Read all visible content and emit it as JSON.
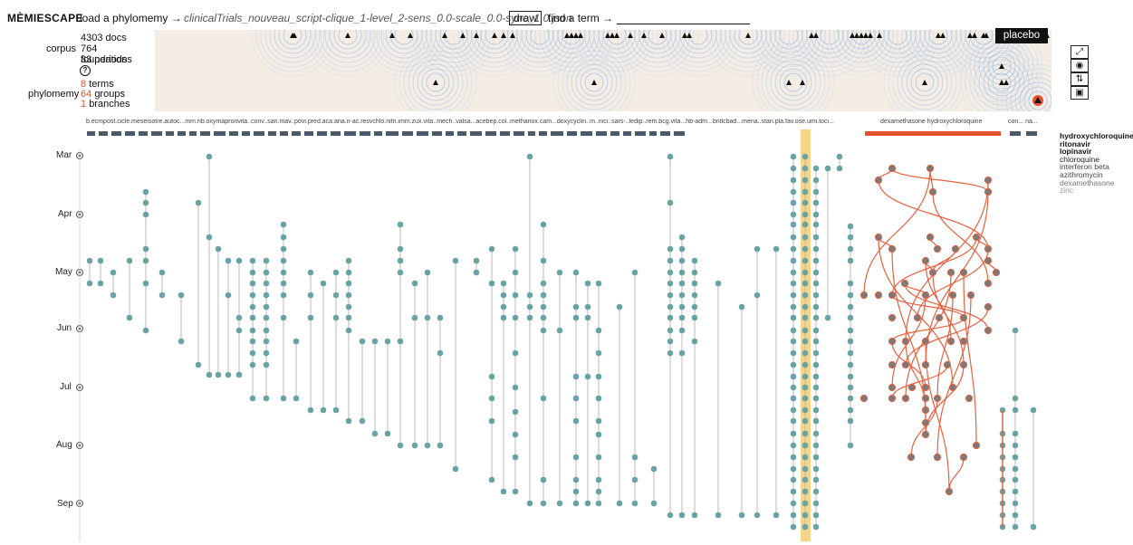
{
  "header": {
    "brand": "MÈMIESCAPE",
    "load_label": "load a phylomemy →",
    "file_name": "clinicalTrials_nouveau_script-clique_1-level_2-sens_0.0-scale_0.0-sync_1.0.json",
    "draw_label": "draw",
    "find_label": "find a term →",
    "find_value": ""
  },
  "stats": {
    "corpus_label": "corpus",
    "docs": "4303 docs",
    "foundations": "764 foundations",
    "periods": "33 periods",
    "help_label": "?",
    "phylomemy_label": "phylomemy",
    "terms_num": "8",
    "terms_label": "terms",
    "groups_num": "64",
    "groups_label": "groups",
    "branches_num": "1",
    "branches_label": "branches"
  },
  "placebo_label": "placebo",
  "term_labels": "b.ecmpost.cicle.meseisotre.autoc...mm.rib.oxymapronvita..conv..sari.mav..povi.pred.aca.ana.n-ac.resvchlo.nitri.imm.zux.vita..mech..valsa...acebep.col..methanox.cam...doxycyclin..m..nici..sars-..ledip..rem.bcg.vita...hb-adm...bntlcbad...mena..stan.pla.fav.ose.umi.toci...",
  "term_label_dexa": "dexamethasone hydroxychloroquine",
  "term_label_tail": "con...   na...",
  "months": [
    "Mar",
    "Apr",
    "May",
    "Jun",
    "Jul",
    "Aug",
    "Sep"
  ],
  "legend": [
    {
      "label": "hydroxychloroquine",
      "color": "#111111",
      "weight": "bold"
    },
    {
      "label": "ritonavir",
      "color": "#111111",
      "weight": "bold"
    },
    {
      "label": "lopinavir",
      "color": "#111111",
      "weight": "bold"
    },
    {
      "label": "chloroquine",
      "color": "#222222",
      "weight": "normal"
    },
    {
      "label": "interferon beta",
      "color": "#444444",
      "weight": "normal"
    },
    {
      "label": "azithromycin",
      "color": "#444444",
      "weight": "normal"
    },
    {
      "label": "dexamethasone",
      "color": "#777777",
      "weight": "normal"
    },
    {
      "label": "zinc",
      "color": "#999999",
      "weight": "normal"
    }
  ],
  "colors": {
    "node": "#6aa3a3",
    "highlight_node": "#7a7a7a",
    "highlight_edge": "#e8603f",
    "band": "#f6d58a",
    "bar": "#4b5868",
    "bar_highlight": "#e4532f"
  },
  "tools": [
    "expand-icon",
    "target-icon",
    "sort-icon",
    "camera-icon"
  ]
}
